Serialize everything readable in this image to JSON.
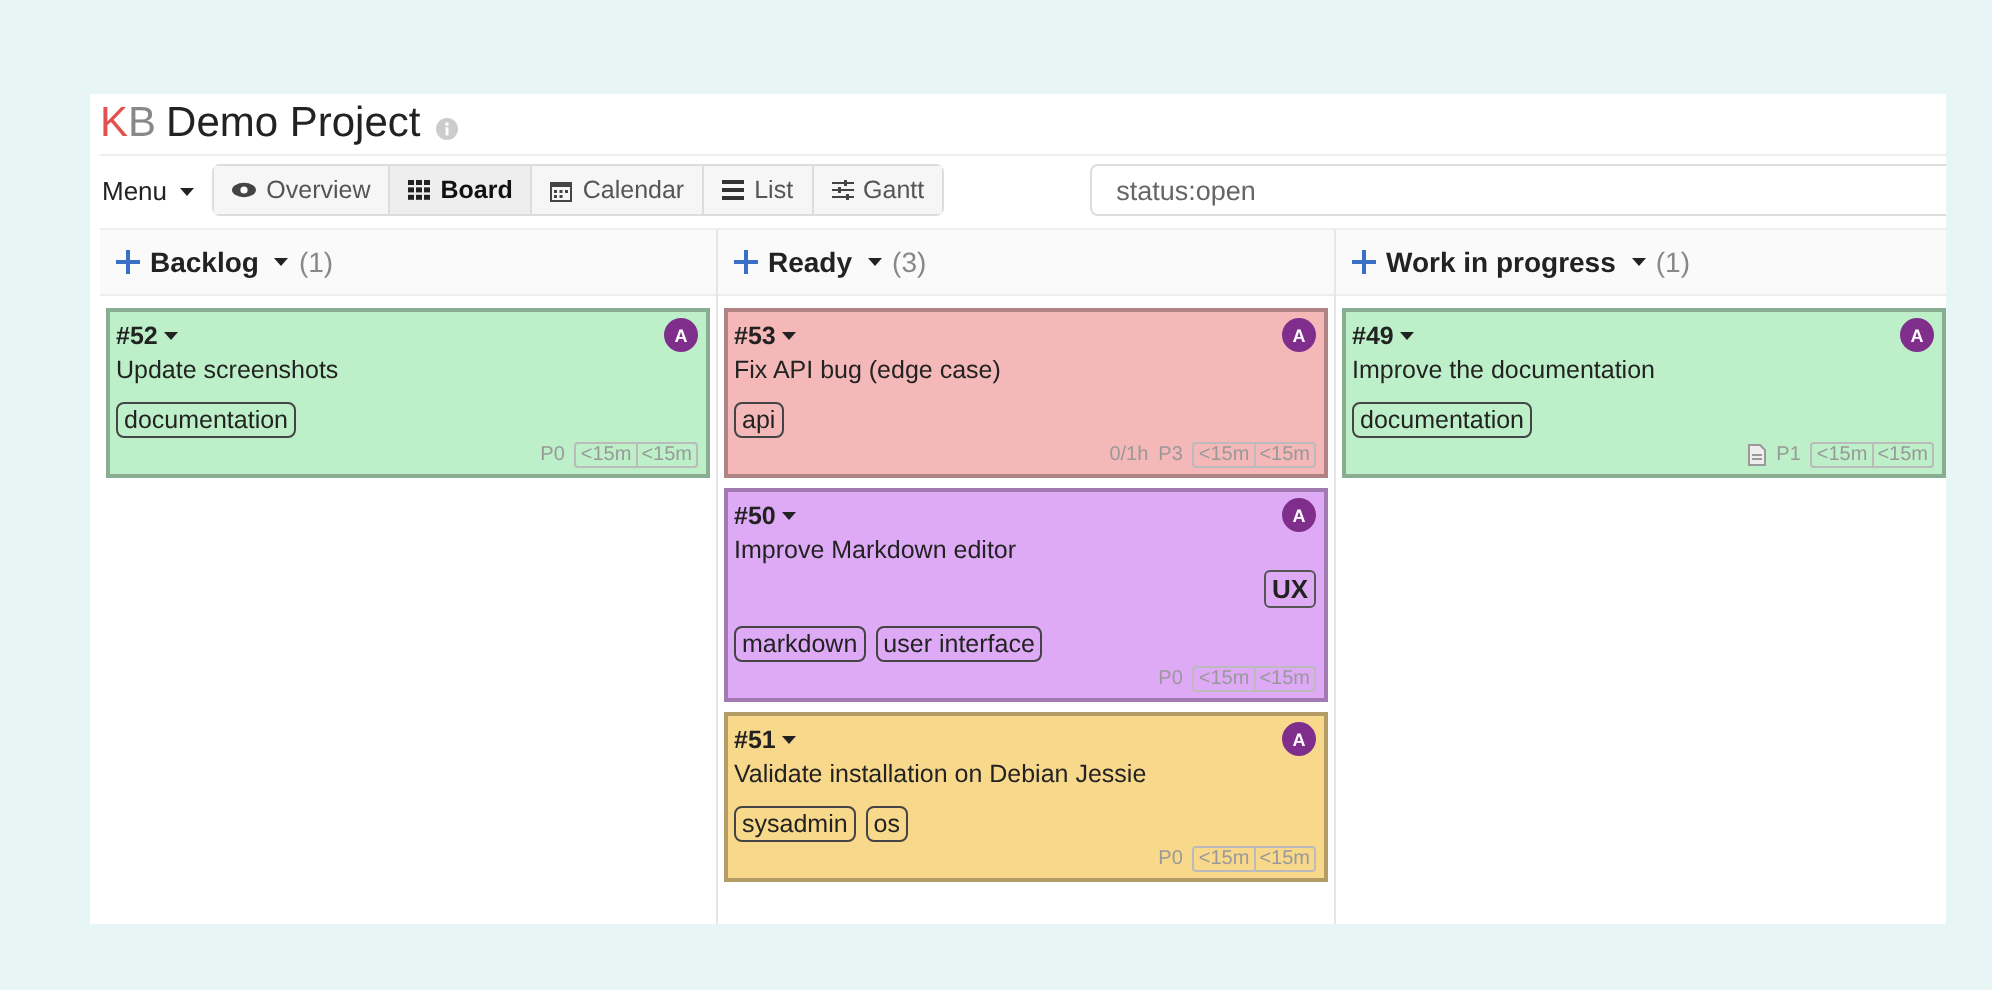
{
  "project": {
    "logo_first": "K",
    "logo_second": "B",
    "title": "Demo Project"
  },
  "menu": {
    "label": "Menu"
  },
  "tabs": [
    {
      "label": "Overview",
      "kind": "eye",
      "selected": false
    },
    {
      "label": "Board",
      "kind": "grid",
      "selected": true
    },
    {
      "label": "Calendar",
      "kind": "calendar",
      "selected": false
    },
    {
      "label": "List",
      "kind": "list",
      "selected": false
    },
    {
      "label": "Gantt",
      "kind": "sliders",
      "selected": false
    }
  ],
  "search": {
    "value": "status:open"
  },
  "columns": [
    {
      "title": "Backlog",
      "count": "(1)",
      "tasks": [
        {
          "number": "#52",
          "title": "Update screenshots",
          "color": "#bdf0c9",
          "avatar": "A",
          "tags": [
            "documentation"
          ],
          "attachment": false,
          "priority": "P0",
          "times": [
            "<15m",
            "<15m"
          ]
        }
      ]
    },
    {
      "title": "Ready",
      "count": "(3)",
      "tasks": [
        {
          "number": "#53",
          "title": "Fix API bug (edge case)",
          "color": "#f4b8b8",
          "avatar": "A",
          "tags": [
            "api"
          ],
          "spent": "0/1h",
          "attachment": false,
          "priority": "P3",
          "times": [
            "<15m",
            "<15m"
          ]
        },
        {
          "number": "#50",
          "title": "Improve Markdown editor",
          "color": "#deaaf6",
          "avatar": "A",
          "category": "UX",
          "tags": [
            "markdown",
            "user interface"
          ],
          "attachment": false,
          "priority": "P0",
          "times": [
            "<15m",
            "<15m"
          ]
        },
        {
          "number": "#51",
          "title": "Validate installation on Debian Jessie",
          "color": "#f8d98c",
          "avatar": "A",
          "tags": [
            "sysadmin",
            "os"
          ],
          "attachment": false,
          "priority": "P0",
          "times": [
            "<15m",
            "<15m"
          ]
        }
      ]
    },
    {
      "title": "Work in progress",
      "count": "(1)",
      "tasks": [
        {
          "number": "#49",
          "title": "Improve the documentation",
          "color": "#bdf0c9",
          "avatar": "A",
          "tags": [
            "documentation"
          ],
          "attachment": true,
          "priority": "P1",
          "times": [
            "<15m",
            "<15m"
          ]
        }
      ]
    }
  ]
}
